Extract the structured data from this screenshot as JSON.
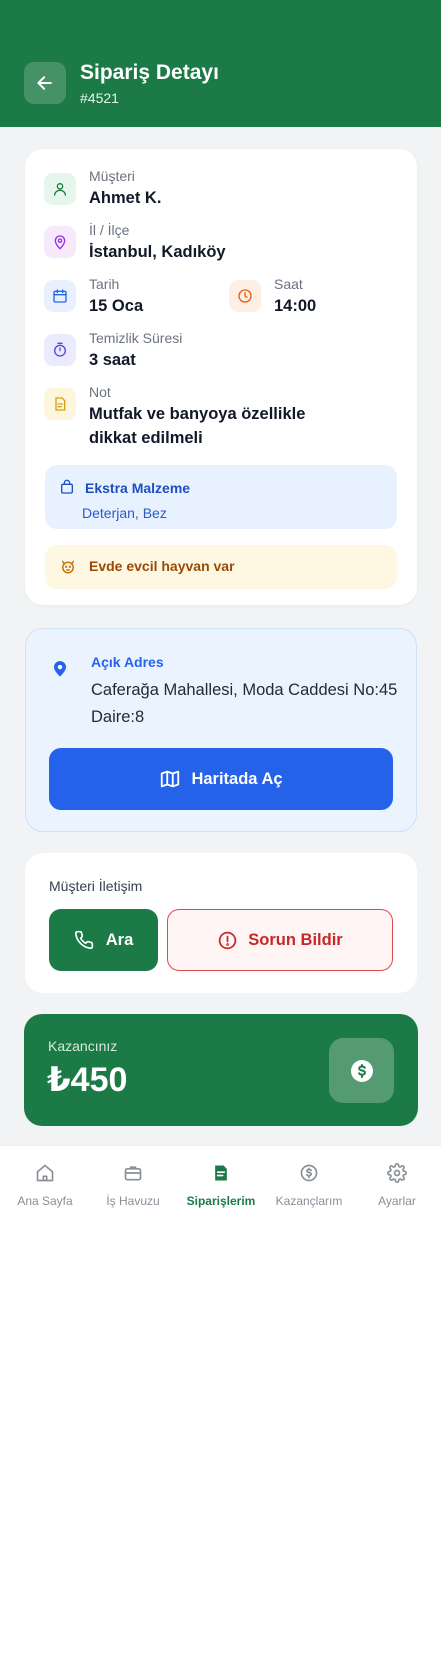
{
  "header": {
    "title": "Sipariş Detayı",
    "order_no": "#4521"
  },
  "details": {
    "customer": {
      "label": "Müşteri",
      "value": "Ahmet K."
    },
    "location": {
      "label": "İl / İlçe",
      "value": "İstanbul, Kadıköy"
    },
    "date": {
      "label": "Tarih",
      "value": "15 Oca"
    },
    "time": {
      "label": "Saat",
      "value": "14:00"
    },
    "duration": {
      "label": "Temizlik Süresi",
      "value": "3 saat"
    },
    "note": {
      "label": "Not",
      "value_line1": "Mutfak ve banyoya özellikle",
      "value_line2": "dikkat edilmeli"
    },
    "extra": {
      "title": "Ekstra Malzeme",
      "value": "Deterjan, Bez"
    },
    "pet": {
      "text": "Evde evcil hayvan var"
    }
  },
  "address": {
    "label": "Açık Adres",
    "line1": "Caferağa Mahallesi, Moda Caddesi No:45",
    "line2": "Daire:8",
    "map_button": "Haritada Aç"
  },
  "contact": {
    "label": "Müşteri İletişim",
    "call_button": "Ara",
    "report_button": "Sorun Bildir"
  },
  "earnings": {
    "label": "Kazancınız",
    "value": "₺450"
  },
  "nav": {
    "items": [
      {
        "label": "Ana Sayfa",
        "icon": "home-icon"
      },
      {
        "label": "İş Havuzu",
        "icon": "briefcase-icon"
      },
      {
        "label": "Siparişlerim",
        "icon": "orders-icon",
        "active": true
      },
      {
        "label": "Kazançlarım",
        "icon": "coin-icon"
      },
      {
        "label": "Ayarlar",
        "icon": "gear-icon"
      }
    ]
  },
  "colors": {
    "primary": "#1b7a45",
    "blue": "#2462ea",
    "danger": "#c62828"
  }
}
